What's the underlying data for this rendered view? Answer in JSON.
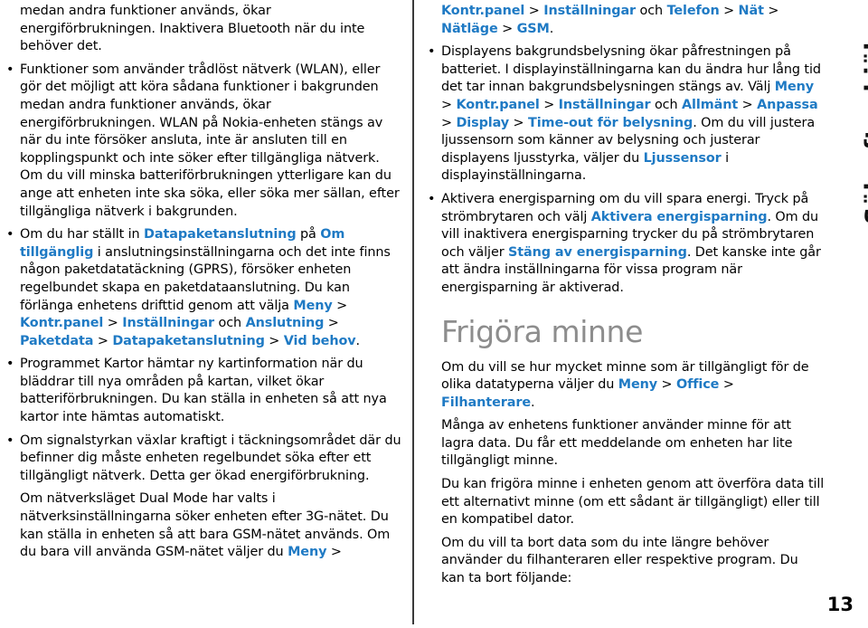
{
  "page": {
    "number": "13",
    "side_tab_label": "Sök efter hjälp",
    "link_color": "#1f7ac4",
    "heading_color": "#8d8d8d",
    "text_color": "#000000",
    "background_color": "#ffffff"
  },
  "left_column": {
    "blocks": [
      {
        "id": "para-bluetooth-continuation",
        "bullet": false,
        "runs": [
          {
            "t": "medan andra funktioner används, ökar energiförbrukningen. Inaktivera Bluetooth när du inte behöver det.",
            "s": "plain"
          }
        ]
      },
      {
        "id": "bullet-wlan",
        "bullet": true,
        "runs": [
          {
            "t": "Funktioner som använder trådlöst nätverk (WLAN), eller gör det möjligt att köra sådana funktioner i bakgrunden medan andra funktioner används, ökar energiförbrukningen. WLAN på Nokia-enheten stängs av när du inte försöker ansluta, inte är ansluten till en kopplingspunkt och inte söker efter tillgängliga nätverk. Om du vill minska batteriförbrukningen ytterligare kan du ange att enheten inte ska söka, eller söka mer sällan, efter tillgängliga nätverk i bakgrunden.",
            "s": "plain"
          }
        ]
      },
      {
        "id": "bullet-datapaket",
        "bullet": true,
        "runs": [
          {
            "t": "Om du har ställt in ",
            "s": "plain"
          },
          {
            "t": "Datapaketanslutning",
            "s": "link"
          },
          {
            "t": " på ",
            "s": "plain"
          },
          {
            "t": "Om tillgänglig",
            "s": "link"
          },
          {
            "t": " i anslutningsinställningarna och det inte finns någon paketdatatäckning (GPRS), försöker enheten regelbundet skapa en paketdataanslutning. Du kan förlänga enhetens drifttid genom att välja ",
            "s": "plain"
          },
          {
            "t": "Meny",
            "s": "link"
          },
          {
            "t": " > ",
            "s": "sep"
          },
          {
            "t": "Kontr.panel",
            "s": "link"
          },
          {
            "t": " > ",
            "s": "sep"
          },
          {
            "t": "Inställningar",
            "s": "link"
          },
          {
            "t": " och ",
            "s": "plain"
          },
          {
            "t": "Anslutning",
            "s": "link"
          },
          {
            "t": " > ",
            "s": "sep"
          },
          {
            "t": "Paketdata",
            "s": "link"
          },
          {
            "t": " > ",
            "s": "sep"
          },
          {
            "t": "Datapaketanslutning",
            "s": "link"
          },
          {
            "t": " > ",
            "s": "sep"
          },
          {
            "t": "Vid behov",
            "s": "link"
          },
          {
            "t": ".",
            "s": "plain"
          }
        ]
      },
      {
        "id": "bullet-kartor",
        "bullet": true,
        "runs": [
          {
            "t": "Programmet Kartor hämtar ny kartinformation när du bläddrar till nya områden på kartan, vilket ökar batteriförbrukningen. Du kan ställa in enheten så att nya kartor inte hämtas automatiskt.",
            "s": "plain"
          }
        ]
      },
      {
        "id": "bullet-signalstyrka",
        "bullet": true,
        "runs": [
          {
            "t": "Om signalstyrkan växlar kraftigt i täckningsområdet där du befinner dig måste enheten regelbundet söka efter ett tillgängligt nätverk. Detta ger ökad energiförbrukning.",
            "s": "plain"
          }
        ]
      },
      {
        "id": "para-dualmode",
        "bullet": false,
        "runs": [
          {
            "t": "Om nätverksläget Dual Mode har valts i nätverksinställningarna söker enheten efter 3G-nätet. Du kan ställa in enheten så att bara GSM-nätet används. Om du bara vill använda GSM-nätet väljer du ",
            "s": "plain"
          },
          {
            "t": "Meny",
            "s": "link"
          },
          {
            "t": " > ",
            "s": "sep"
          }
        ]
      }
    ]
  },
  "right_column": {
    "blocks": [
      {
        "id": "para-dualmode-continuation",
        "bullet": false,
        "runs": [
          {
            "t": "Kontr.panel",
            "s": "link"
          },
          {
            "t": " > ",
            "s": "sep"
          },
          {
            "t": "Inställningar",
            "s": "link"
          },
          {
            "t": " och ",
            "s": "plain"
          },
          {
            "t": "Telefon",
            "s": "link"
          },
          {
            "t": " > ",
            "s": "sep"
          },
          {
            "t": "Nät",
            "s": "link"
          },
          {
            "t": " > ",
            "s": "sep"
          },
          {
            "t": "Nätläge",
            "s": "link"
          },
          {
            "t": " > ",
            "s": "sep"
          },
          {
            "t": "GSM",
            "s": "link"
          },
          {
            "t": ".",
            "s": "plain"
          }
        ]
      },
      {
        "id": "bullet-bakgrundsbelysning",
        "bullet": true,
        "runs": [
          {
            "t": "Displayens bakgrundsbelysning ökar påfrestningen på batteriet. I displayinställningarna kan du ändra hur lång tid det tar innan bakgrundsbelysningen stängs av. Välj ",
            "s": "plain"
          },
          {
            "t": "Meny",
            "s": "link"
          },
          {
            "t": " > ",
            "s": "sep"
          },
          {
            "t": "Kontr.panel",
            "s": "link"
          },
          {
            "t": " > ",
            "s": "sep"
          },
          {
            "t": "Inställningar",
            "s": "link"
          },
          {
            "t": " och ",
            "s": "plain"
          },
          {
            "t": "Allmänt",
            "s": "link"
          },
          {
            "t": " > ",
            "s": "sep"
          },
          {
            "t": "Anpassa",
            "s": "link"
          },
          {
            "t": " > ",
            "s": "sep"
          },
          {
            "t": "Display",
            "s": "link"
          },
          {
            "t": " > ",
            "s": "sep"
          },
          {
            "t": "Time-out för belysning",
            "s": "link"
          },
          {
            "t": ". Om du vill justera ljussensorn som känner av belysning och justerar displayens ljusstyrka, väljer du ",
            "s": "plain"
          },
          {
            "t": "Ljussensor",
            "s": "link"
          },
          {
            "t": " i displayinställningarna.",
            "s": "plain"
          }
        ]
      },
      {
        "id": "bullet-energisparning",
        "bullet": true,
        "runs": [
          {
            "t": "Aktivera energisparning om du vill spara energi. Tryck på strömbrytaren och välj ",
            "s": "plain"
          },
          {
            "t": "Aktivera energisparning",
            "s": "link"
          },
          {
            "t": ". Om du vill inaktivera energisparning trycker du på strömbrytaren och väljer ",
            "s": "plain"
          },
          {
            "t": "Stäng av energisparning",
            "s": "link"
          },
          {
            "t": ". Det kanske inte går att ändra inställningarna för vissa program när energisparning är aktiverad.",
            "s": "plain"
          }
        ]
      }
    ],
    "heading": "Frigöra minne",
    "after_heading_blocks": [
      {
        "id": "para-minne-intro",
        "bullet": false,
        "runs": [
          {
            "t": "Om du vill se hur mycket minne som är tillgängligt för de olika datatyperna väljer du ",
            "s": "plain"
          },
          {
            "t": "Meny",
            "s": "link"
          },
          {
            "t": " > ",
            "s": "sep"
          },
          {
            "t": "Office",
            "s": "link"
          },
          {
            "t": " > ",
            "s": "sep"
          },
          {
            "t": "Filhanterare",
            "s": "link"
          },
          {
            "t": ".",
            "s": "plain"
          }
        ]
      },
      {
        "id": "para-minne-lagra",
        "bullet": false,
        "runs": [
          {
            "t": "Många av enhetens funktioner använder minne för att lagra data. Du får ett meddelande om enheten har lite tillgängligt minne.",
            "s": "plain"
          }
        ]
      },
      {
        "id": "para-minne-frigora",
        "bullet": false,
        "runs": [
          {
            "t": "Du kan frigöra minne i enheten genom att överföra data till ett alternativt minne (om ett sådant är tillgängligt) eller till en kompatibel dator.",
            "s": "plain"
          }
        ]
      },
      {
        "id": "para-minne-tabort",
        "bullet": false,
        "runs": [
          {
            "t": "Om du vill ta bort data som du inte längre behöver använder du filhanteraren eller respektive program. Du kan ta bort följande:",
            "s": "plain"
          }
        ]
      }
    ]
  }
}
